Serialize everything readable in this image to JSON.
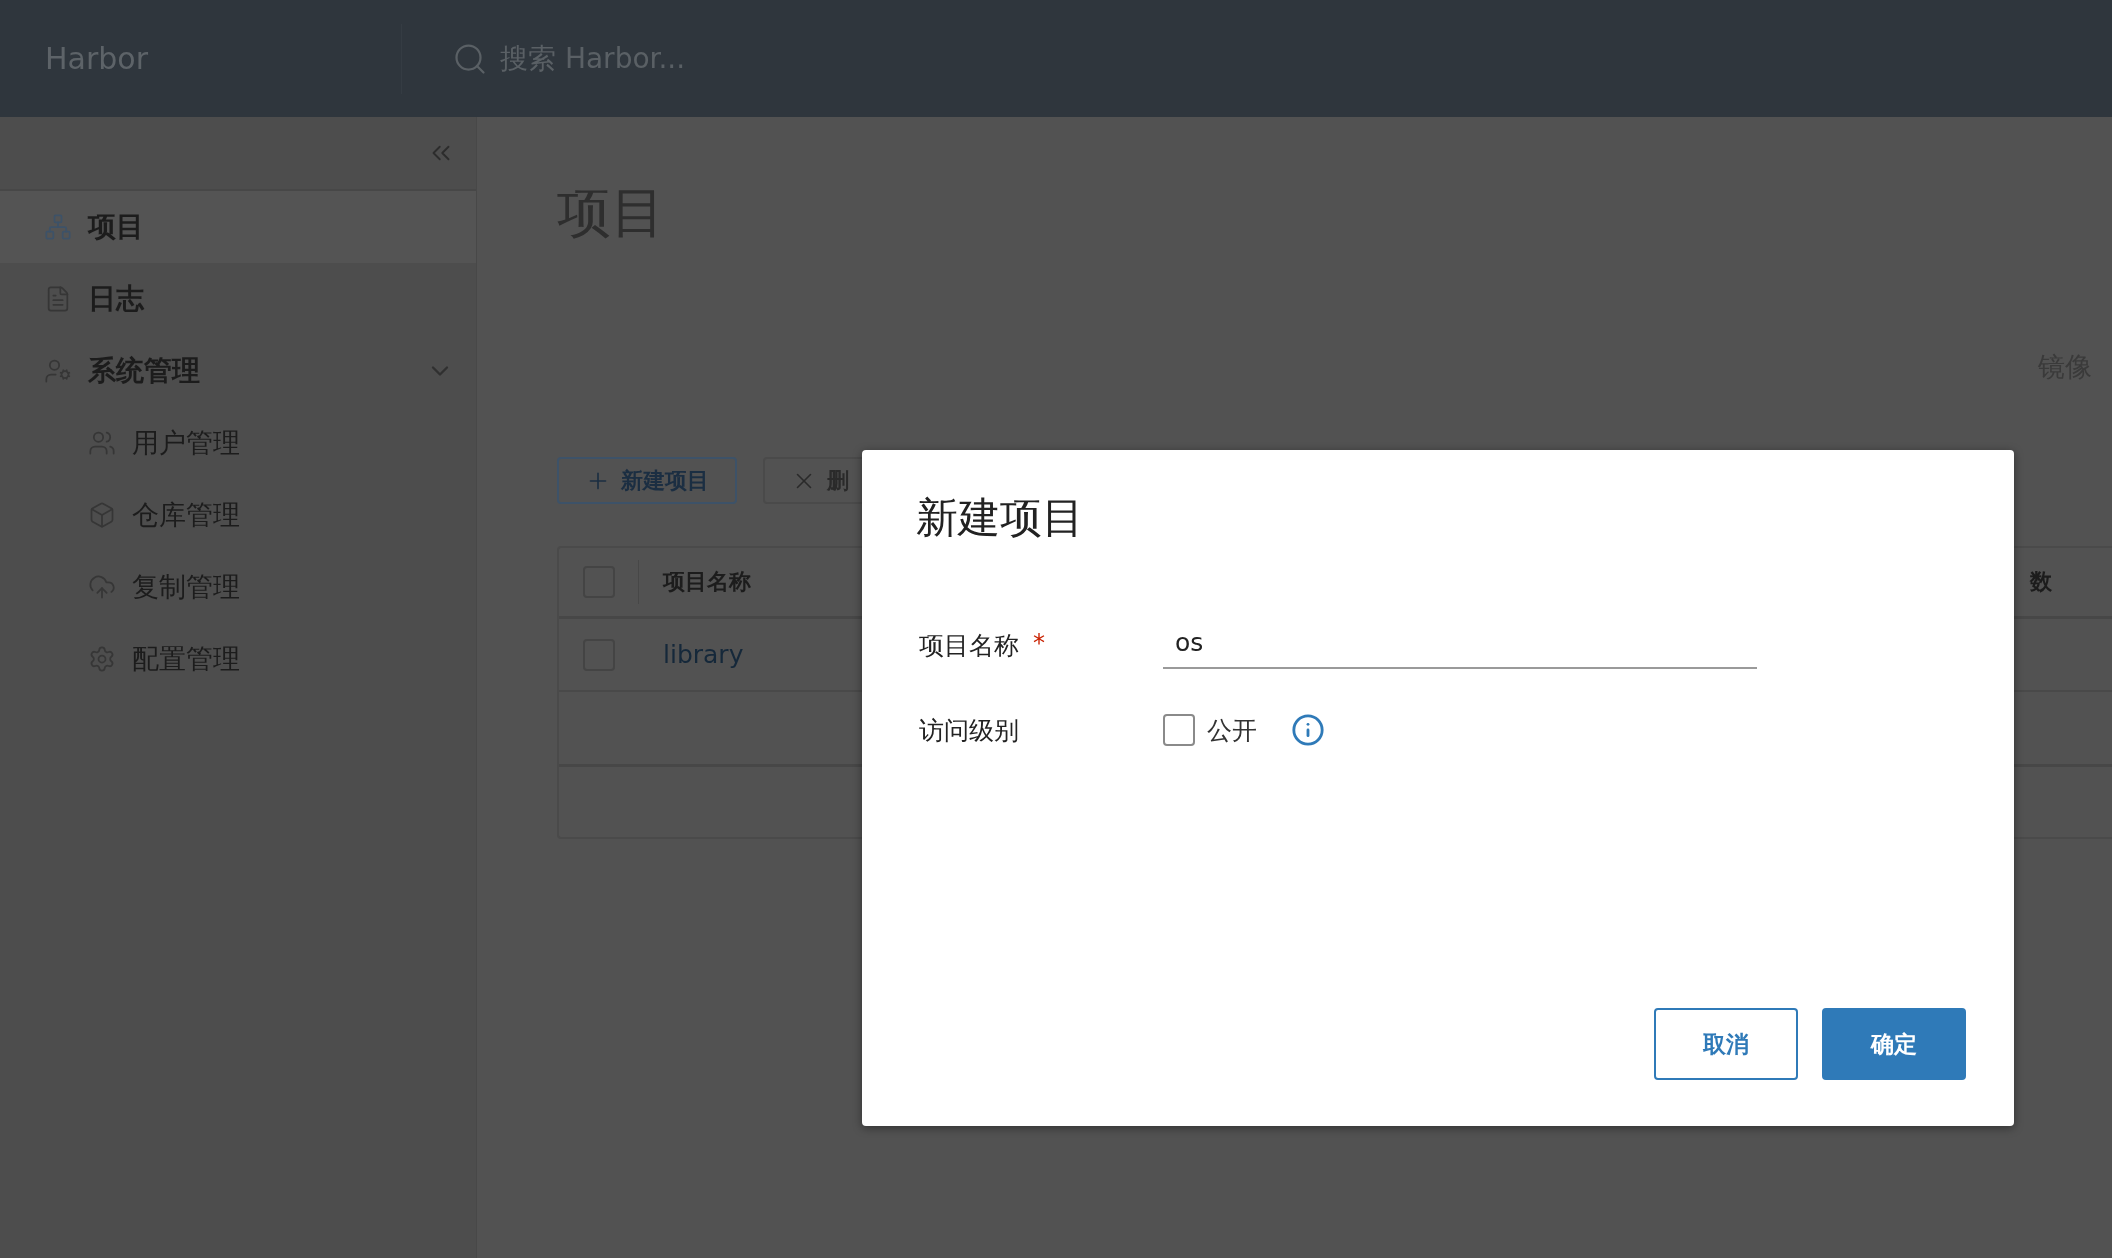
{
  "header": {
    "brand": "Harbor",
    "search": {
      "placeholder": "搜索 Harbor..."
    }
  },
  "sidebar": {
    "items": [
      {
        "label": "项目",
        "kind": "projects",
        "selected": true
      },
      {
        "label": "日志",
        "kind": "logs",
        "selected": false
      },
      {
        "label": "系统管理",
        "kind": "admin",
        "selected": false,
        "expanded": true,
        "children": [
          {
            "label": "用户管理",
            "kind": "users",
            "selected": false
          },
          {
            "label": "仓库管理",
            "kind": "box",
            "selected": false
          },
          {
            "label": "复制管理",
            "kind": "cloud",
            "selected": false
          },
          {
            "label": "配置管理",
            "kind": "gear",
            "selected": false
          }
        ]
      }
    ]
  },
  "main": {
    "title": "项目",
    "side_texts": [
      "镜像"
    ],
    "toolbar": [
      {
        "label": "新建项目",
        "kind": "add"
      },
      {
        "label": "删",
        "kind": "delete"
      }
    ],
    "table": {
      "all_checked": false,
      "columns": [
        "项目名称",
        "数"
      ],
      "rows": [
        {
          "name": "library",
          "checked": false
        }
      ]
    }
  },
  "dialog": {
    "title": "新建项目",
    "fields": [
      {
        "kind": "text",
        "label": "项目名称",
        "required_mark": "*",
        "value": "os"
      },
      {
        "kind": "checkbox",
        "label": "访问级别",
        "option": "公开",
        "checked": false
      }
    ],
    "buttons": [
      {
        "label": "取消",
        "kind": "secondary"
      },
      {
        "label": "确定",
        "kind": "primary"
      }
    ]
  }
}
